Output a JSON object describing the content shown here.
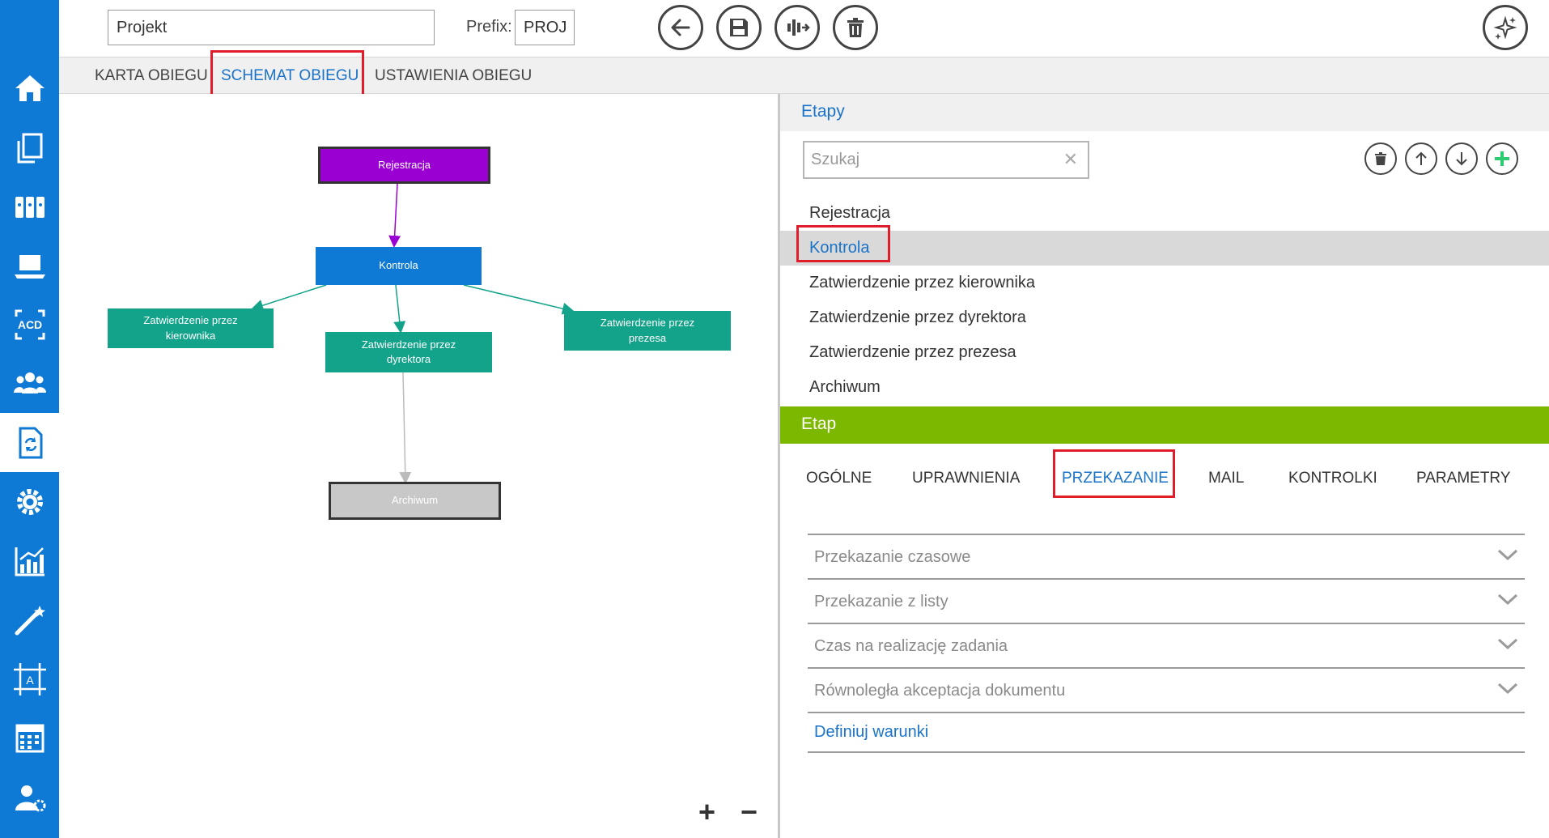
{
  "sidebar": {
    "items": [
      {
        "icon": "home-icon"
      },
      {
        "icon": "documents-icon"
      },
      {
        "icon": "binders-icon"
      },
      {
        "icon": "laptop-icon"
      },
      {
        "icon": "acd-icon",
        "label": "ACD"
      },
      {
        "icon": "users-icon"
      },
      {
        "icon": "workflow-doc-icon",
        "active": true
      },
      {
        "icon": "gear-icon"
      },
      {
        "icon": "chart-icon"
      },
      {
        "icon": "magic-wand-icon"
      },
      {
        "icon": "template-icon",
        "label": "A"
      },
      {
        "icon": "calendar-icon"
      },
      {
        "icon": "user-settings-icon"
      }
    ]
  },
  "header": {
    "name_value": "Projekt",
    "prefix_label": "Prefix:",
    "prefix_value": "PROJ",
    "buttons": [
      "back-icon",
      "save-icon",
      "workflow-add-icon",
      "trash-icon"
    ],
    "assistant_icon": "sparkles-icon"
  },
  "tabs": [
    {
      "label": "KARTA OBIEGU",
      "active": false
    },
    {
      "label": "SCHEMAT OBIEGU",
      "active": true
    },
    {
      "label": "USTAWIENIA OBIEGU",
      "active": false
    }
  ],
  "diagram": {
    "nodes": {
      "rejestracja": "Rejestracja",
      "kontrola": "Kontrola",
      "kierownik_l1": "Zatwierdzenie przez",
      "kierownik_l2": "kierownika",
      "dyrektor_l1": "Zatwierdzenie przez",
      "dyrektor_l2": "dyrektora",
      "prezes_l1": "Zatwierdzenie przez",
      "prezes_l2": "prezesa",
      "archiwum": "Archiwum"
    },
    "colors": {
      "rejestracja": "#9b00d3",
      "kontrola": "#0e7ad6",
      "approval": "#13a38a",
      "archiwum": "#c8c8c8"
    },
    "zoom_in": "+",
    "zoom_out": "−"
  },
  "stages": {
    "title": "Etapy",
    "search_placeholder": "Szukaj",
    "toolbar": [
      "trash-icon",
      "arrow-up-icon",
      "arrow-down-icon",
      "add-icon"
    ],
    "items": [
      {
        "label": "Rejestracja"
      },
      {
        "label": "Kontrola",
        "selected": true
      },
      {
        "label": "Zatwierdzenie przez kierownika"
      },
      {
        "label": "Zatwierdzenie przez dyrektora"
      },
      {
        "label": "Zatwierdzenie przez prezesa"
      },
      {
        "label": "Archiwum"
      }
    ]
  },
  "stage": {
    "title": "Etap",
    "tabs": [
      {
        "label": "OGÓLNE"
      },
      {
        "label": "UPRAWNIENIA"
      },
      {
        "label": "PRZEKAZANIE",
        "active": true
      },
      {
        "label": "MAIL"
      },
      {
        "label": "KONTROLKI"
      },
      {
        "label": "PARAMETRY"
      }
    ],
    "sections": [
      {
        "label": "Przekazanie czasowe"
      },
      {
        "label": "Przekazanie z listy"
      },
      {
        "label": "Czas na realizację zadania"
      },
      {
        "label": "Równoległa akceptacja dokumentu"
      }
    ],
    "define_link": "Definiuj warunki"
  }
}
